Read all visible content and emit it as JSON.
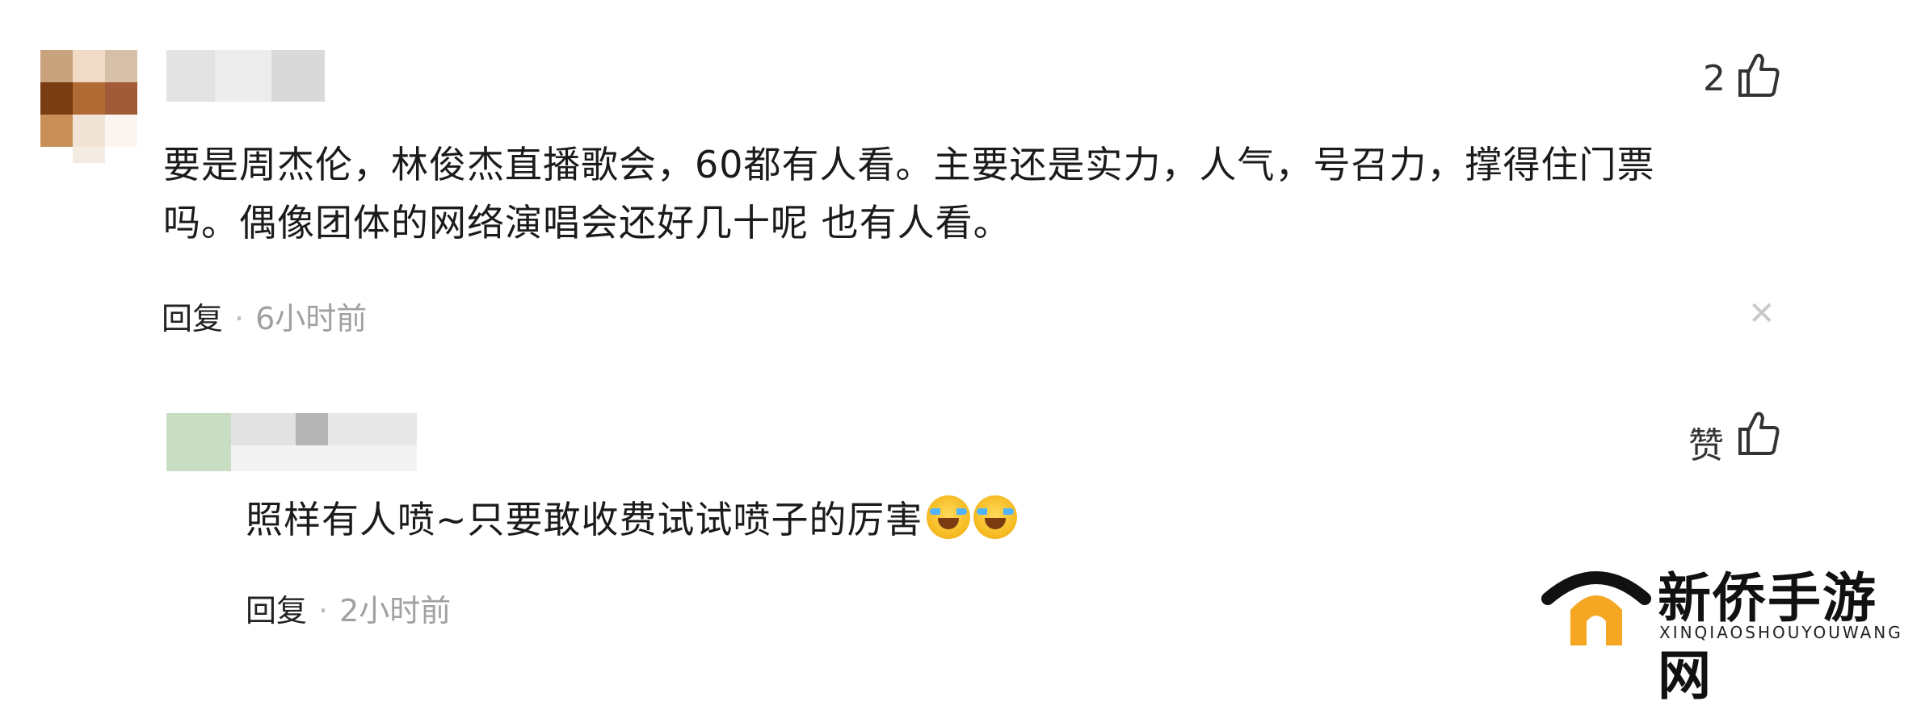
{
  "comments": [
    {
      "likes": "2",
      "text_line1": "要是周杰伦，林俊杰直播歌会，60都有人看。主要还是实力，人气，号召力，撑得住门票",
      "text_line2": "吗。偶像团体的网络演唱会还好几十呢 也有人看。",
      "reply_label": "回复",
      "separator": "·",
      "time": "6小时前",
      "close_glyph": "✕"
    },
    {
      "likes": "赞",
      "text": "照样有人喷~只要敢收费试试喷子的厉害",
      "reply_label": "回复",
      "separator": "·",
      "time": "2小时前"
    }
  ],
  "icons": {
    "like": "thumbs-up-icon",
    "close": "close-icon",
    "emoji": "crying-laughing-emoji-icon"
  },
  "watermark": {
    "title": "新侨手游网",
    "subtitle": "XINQIAOSHOUYOUWANG",
    "accent_color": "#f5a623"
  }
}
